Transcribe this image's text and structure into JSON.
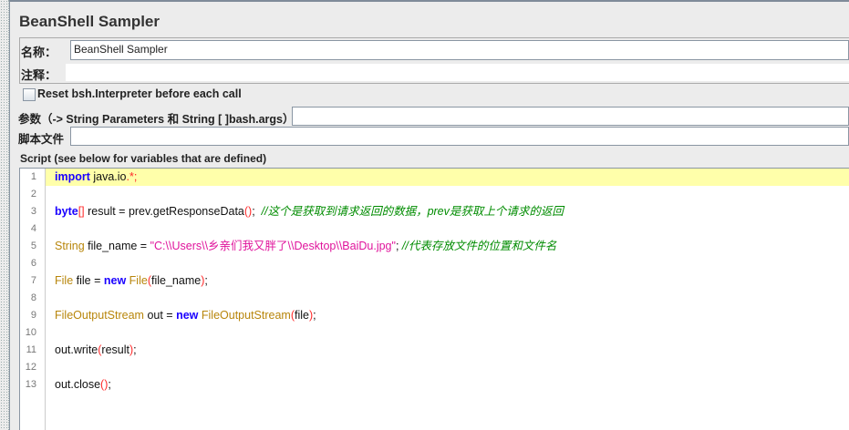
{
  "title": "BeanShell Sampler",
  "name_label": "名称：",
  "name_value": "BeanShell Sampler",
  "comment_label": "注释：",
  "comment_value": "",
  "reset_label": "Reset bsh.Interpreter before each call",
  "reset_checked": false,
  "params_label": "参数（-> String Parameters 和 String [ ]bash.args）",
  "params_value": "",
  "file_label": "脚本文件",
  "file_value": "",
  "script_label": "Script (see below for variables that are defined)",
  "code": [
    [
      [
        "import",
        "kw"
      ],
      [
        " java.io",
        "id"
      ],
      [
        ".*;",
        "op"
      ]
    ],
    [],
    [
      [
        "byte",
        "kw"
      ],
      [
        "[]",
        "op"
      ],
      [
        " result = prev.getResponseData",
        "id"
      ],
      [
        "()",
        "op"
      ],
      [
        ";  ",
        "id"
      ],
      [
        "//这个是获取到请求返回的数据，prev是获取上个请求的返回",
        "cm"
      ]
    ],
    [],
    [
      [
        "String",
        "ty"
      ],
      [
        " file_name = ",
        "id"
      ],
      [
        "\"C:\\\\Users\\\\乡亲们我又胖了\\\\Desktop\\\\BaiDu.jpg\"",
        "str"
      ],
      [
        "; ",
        "id"
      ],
      [
        "//代表存放文件的位置和文件名",
        "cm"
      ]
    ],
    [],
    [
      [
        "File",
        "ty"
      ],
      [
        " file = ",
        "id"
      ],
      [
        "new",
        "kw"
      ],
      [
        " ",
        "id"
      ],
      [
        "File",
        "ty"
      ],
      [
        "(",
        "op"
      ],
      [
        "file_name",
        "id"
      ],
      [
        ")",
        "op"
      ],
      [
        ";",
        "id"
      ]
    ],
    [],
    [
      [
        "FileOutputStream",
        "ty"
      ],
      [
        " out = ",
        "id"
      ],
      [
        "new",
        "kw"
      ],
      [
        " ",
        "id"
      ],
      [
        "FileOutputStream",
        "ty"
      ],
      [
        "(",
        "op"
      ],
      [
        "file",
        "id"
      ],
      [
        ")",
        "op"
      ],
      [
        ";",
        "id"
      ]
    ],
    [],
    [
      [
        "out.write",
        "id"
      ],
      [
        "(",
        "op"
      ],
      [
        "result",
        "id"
      ],
      [
        ")",
        "op"
      ],
      [
        ";",
        "id"
      ]
    ],
    [],
    [
      [
        "out.close",
        "id"
      ],
      [
        "()",
        "op"
      ],
      [
        ";",
        "id"
      ]
    ]
  ]
}
